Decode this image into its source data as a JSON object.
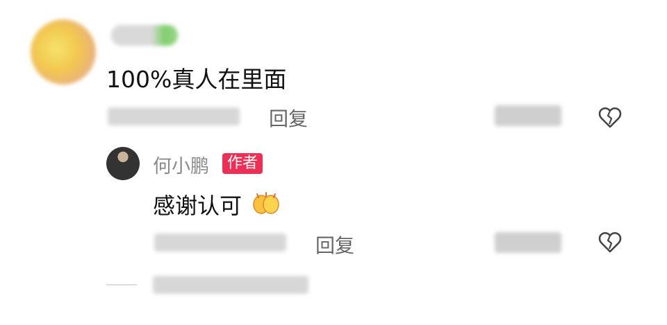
{
  "comment": {
    "text": "100%真人在里面",
    "reply_label": "回复"
  },
  "sub_reply": {
    "author_name": "何小鹏",
    "author_badge": "作者",
    "text": "感谢认可",
    "reply_label": "回复"
  },
  "colors": {
    "badge_bg": "#ee2e55",
    "meta_text": "#666666",
    "primary_text": "#111111"
  },
  "icons": {
    "like": "heart-icon",
    "reaction_emoji": "clapping-hands-emoji"
  }
}
